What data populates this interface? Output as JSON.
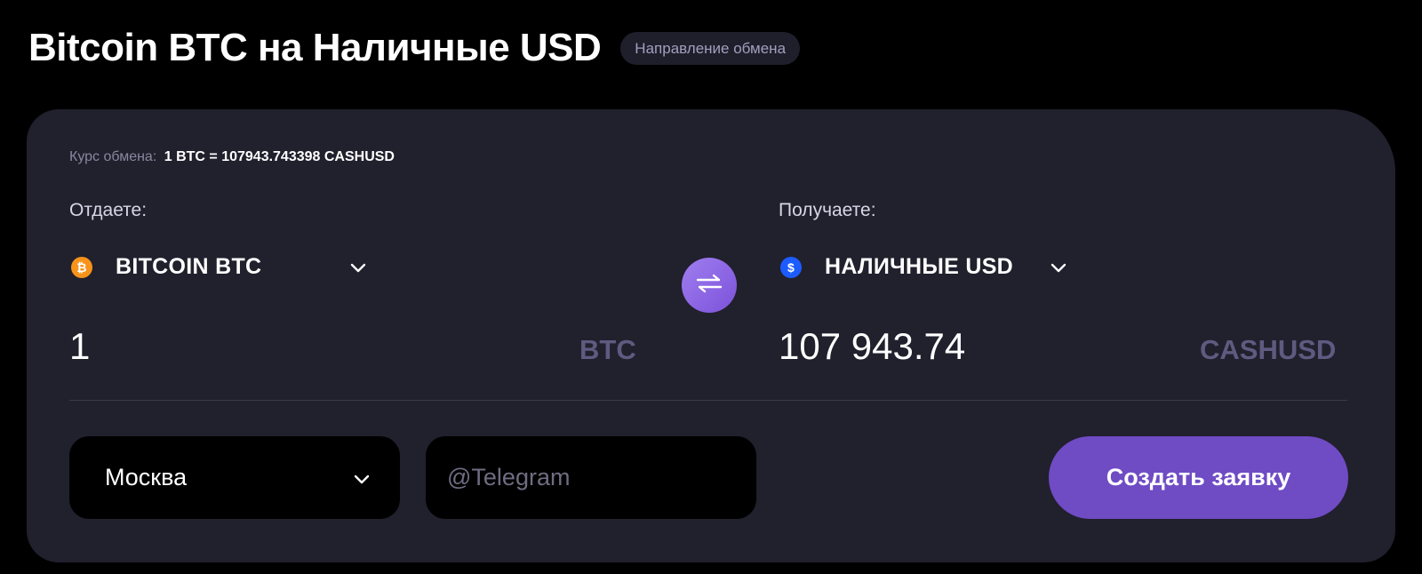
{
  "header": {
    "title": "Bitcoin BTC на Наличные USD",
    "badge": "Направление обмена"
  },
  "rate": {
    "label": "Курс обмена:",
    "value": "1 BTC = 107943.743398 CASHUSD"
  },
  "give": {
    "label": "Отдаете:",
    "currency_name": "BITCOIN BTC",
    "currency_icon": "bitcoin-icon",
    "icon_glyph": "₿",
    "amount": "1",
    "unit": "BTC"
  },
  "receive": {
    "label": "Получаете:",
    "currency_name": "НАЛИЧНЫЕ USD",
    "currency_icon": "dollar-icon",
    "icon_glyph": "$",
    "amount": "107 943.74",
    "unit": "CASHUSD"
  },
  "form": {
    "city": "Москва",
    "telegram_placeholder": "@Telegram",
    "submit_label": "Создать заявку"
  },
  "colors": {
    "background": "#000000",
    "card": "#21202d",
    "accent": "#6f4bc4",
    "btc": "#f7931a",
    "usd": "#1c5cff",
    "unit_text": "#5f5a80"
  }
}
